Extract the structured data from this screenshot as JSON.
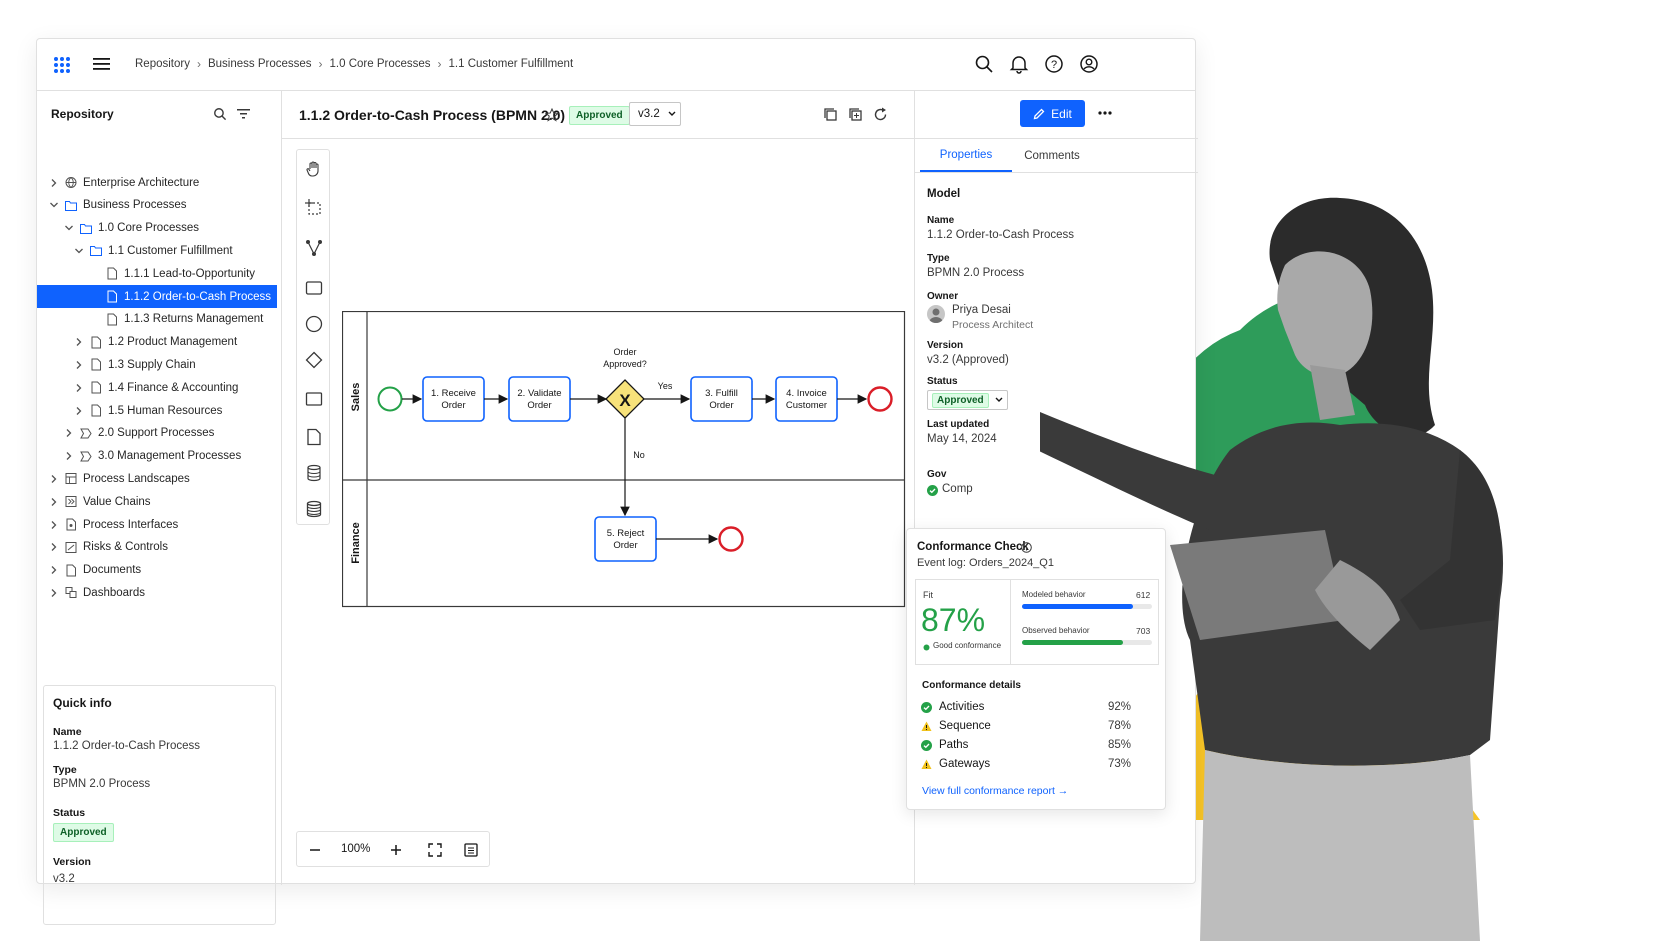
{
  "breadcrumb": [
    "Repository",
    "Business Processes",
    "1.0 Core Processes",
    "1.1 Customer Fulfillment"
  ],
  "sidebar": {
    "title": "Repository",
    "tree": [
      {
        "label": "Enterprise Architecture",
        "depth": 0,
        "chevron": "right",
        "icon": "globe-icon"
      },
      {
        "label": "Business Processes",
        "depth": 0,
        "chevron": "down",
        "icon": "folder-icon"
      },
      {
        "label": "1.0 Core Processes",
        "depth": 1,
        "chevron": "down",
        "icon": "folder-icon"
      },
      {
        "label": "1.1 Customer Fulfillment",
        "depth": 2,
        "chevron": "down",
        "icon": "folder-icon"
      },
      {
        "label": "1.1.1 Lead-to-Opportunity",
        "depth": 3,
        "chevron": "",
        "icon": "document-icon"
      },
      {
        "label": "1.1.2 Order-to-Cash Process",
        "depth": 3,
        "chevron": "",
        "icon": "document-icon",
        "selected": true
      },
      {
        "label": "1.1.3 Returns Management",
        "depth": 3,
        "chevron": "",
        "icon": "document-icon"
      },
      {
        "label": "1.2 Product Management",
        "depth": 2,
        "chevron": "right",
        "icon": "document-icon"
      },
      {
        "label": "1.3 Supply Chain",
        "depth": 2,
        "chevron": "right",
        "icon": "document-icon"
      },
      {
        "label": "1.4 Finance & Accounting",
        "depth": 2,
        "chevron": "right",
        "icon": "document-icon"
      },
      {
        "label": "1.5 Human Resources",
        "depth": 2,
        "chevron": "right",
        "icon": "document-icon"
      },
      {
        "label": "2.0 Support Processes",
        "depth": 1,
        "chevron": "right",
        "icon": "process-icon"
      },
      {
        "label": "3.0 Management Processes",
        "depth": 1,
        "chevron": "right",
        "icon": "process-icon"
      },
      {
        "label": "Process Landscapes",
        "depth": 0,
        "chevron": "right",
        "icon": "landscape-icon"
      },
      {
        "label": "Value Chains",
        "depth": 0,
        "chevron": "right",
        "icon": "value-chain-icon"
      },
      {
        "label": "Process Interfaces",
        "depth": 0,
        "chevron": "right",
        "icon": "interface-icon"
      },
      {
        "label": "Risks & Controls",
        "depth": 0,
        "chevron": "right",
        "icon": "risk-icon"
      },
      {
        "label": "Documents",
        "depth": 0,
        "chevron": "right",
        "icon": "document-icon"
      },
      {
        "label": "Dashboards",
        "depth": 0,
        "chevron": "right",
        "icon": "dashboard-icon"
      }
    ],
    "quick_info": {
      "title": "Quick info",
      "name_label": "Name",
      "name": "1.1.2 Order-to-Cash Process",
      "type_label": "Type",
      "type": "BPMN 2.0 Process",
      "status_label": "Status",
      "status": "Approved",
      "version_label": "Version",
      "version": "v3.2"
    }
  },
  "model": {
    "title": "1.1.2 Order-to-Cash Process (BPMN 2.0)",
    "status": "Approved",
    "version": "v3.2",
    "edit_label": "Edit",
    "zoom": "100%"
  },
  "diagram": {
    "lanes": [
      "Sales",
      "Finance"
    ],
    "tasks": [
      "1. Receive Order",
      "2. Validate Order",
      "3. Fulfill Order",
      "4. Invoice Customer",
      "5. Reject Order"
    ],
    "gateway_label": "Order Approved?",
    "gateway_symbol": "X",
    "yes_label": "Yes",
    "no_label": "No"
  },
  "properties": {
    "tabs": [
      "Properties",
      "Comments"
    ],
    "active_tab": "Properties",
    "section": "Model",
    "name_label": "Name",
    "name": "1.1.2 Order-to-Cash Process",
    "type_label": "Type",
    "type": "BPMN 2.0 Process",
    "owner_label": "Owner",
    "owner_name": "Priya Desai",
    "owner_role": "Process Architect",
    "version_label": "Version",
    "version": "v3.2 (Approved)",
    "status_label": "Status",
    "status": "Approved",
    "updated_label": "Last updated",
    "updated": "May 14, 2024",
    "gov_label": "Gov",
    "gov_value": "Comp"
  },
  "conformance": {
    "title": "Conformance Check",
    "event_log": "Event log: Orders_2024_Q1",
    "fit_label": "Fit",
    "fit_value": "87%",
    "fit_note": "Good conformance",
    "modeled_label": "Modeled behavior",
    "modeled_value": "612",
    "modeled_fraction": 0.85,
    "observed_label": "Observed behavior",
    "observed_value": "703",
    "observed_fraction": 0.78,
    "details_title": "Conformance details",
    "details": [
      {
        "label": "Activities",
        "value": "92%",
        "status": "ok"
      },
      {
        "label": "Sequence",
        "value": "78%",
        "status": "warn"
      },
      {
        "label": "Paths",
        "value": "85%",
        "status": "ok"
      },
      {
        "label": "Gateways",
        "value": "73%",
        "status": "warn"
      }
    ],
    "report_link": "View full conformance report →"
  },
  "colors": {
    "accent": "#0f62fe",
    "success": "#24a148",
    "warning": "#f1c21b",
    "error": "#da1e28",
    "green_shape": "#2e9c5a",
    "yellow_shape": "#f7c426"
  }
}
